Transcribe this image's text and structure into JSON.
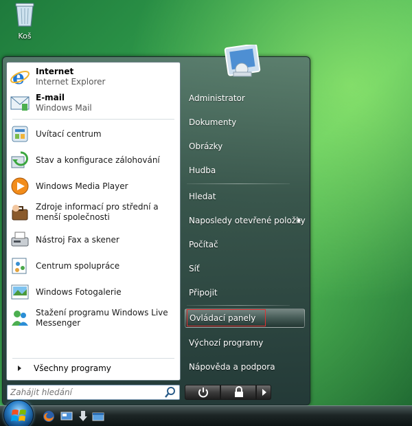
{
  "desktop": {
    "recycle_bin_label": "Koš"
  },
  "pinned": [
    {
      "title": "Internet",
      "subtitle": "Internet Explorer",
      "icon": "internet-explorer-icon"
    },
    {
      "title": "E-mail",
      "subtitle": "Windows Mail",
      "icon": "windows-mail-icon"
    }
  ],
  "recent": [
    {
      "label": "Uvítací centrum",
      "icon": "welcome-center-icon"
    },
    {
      "label": "Stav a konfigurace zálohování",
      "icon": "backup-icon"
    },
    {
      "label": "Windows Media Player",
      "icon": "media-player-icon"
    },
    {
      "label": "Zdroje informací pro střední a menší společnosti",
      "icon": "business-resources-icon"
    },
    {
      "label": "Nástroj Fax a skener",
      "icon": "fax-scanner-icon"
    },
    {
      "label": "Centrum spolupráce",
      "icon": "meeting-space-icon"
    },
    {
      "label": "Windows Fotogalerie",
      "icon": "photo-gallery-icon"
    },
    {
      "label": "Stažení programu Windows Live Messenger",
      "icon": "messenger-icon"
    }
  ],
  "all_programs_label": "Všechny programy",
  "search": {
    "placeholder": "Zahájit hledání"
  },
  "right": {
    "user": "Administrator",
    "documents": "Dokumenty",
    "pictures": "Obrázky",
    "music": "Hudba",
    "search": "Hledat",
    "recent_items": "Naposledy otevřené položky",
    "computer": "Počítač",
    "network": "Síť",
    "connect_to": "Připojit",
    "control_panel": "Ovládací panely",
    "default_programs": "Výchozí programy",
    "help": "Nápověda a podpora"
  },
  "colors": {
    "highlight_box": "#e03030",
    "accent": "#2a7fc8"
  }
}
